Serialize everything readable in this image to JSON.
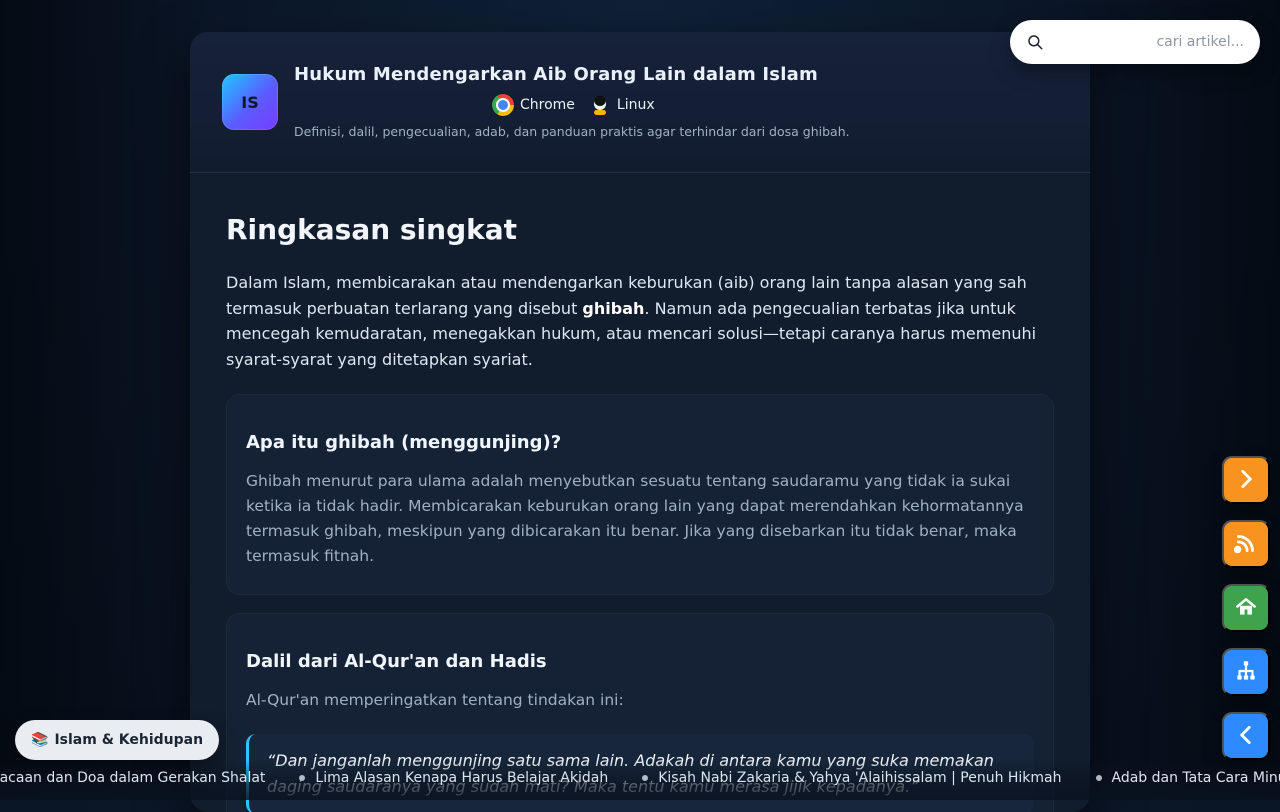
{
  "header": {
    "logo_text": "IS",
    "title": "Hukum Mendengarkan Aib Orang Lain dalam Islam",
    "browser": "Chrome",
    "os": "Linux",
    "subtitle": "Definisi, dalil, pengecualian, adab, dan panduan praktis agar terhindar dari dosa ghibah."
  },
  "search": {
    "placeholder": "cari artikel..."
  },
  "main": {
    "h2": "Ringkasan singkat",
    "lead_prefix": "Dalam Islam, membicarakan atau mendengarkan keburukan (aib) orang lain tanpa alasan yang sah termasuk perbuatan terlarang yang disebut ",
    "lead_bold": "ghibah",
    "lead_suffix": ". Namun ada pengecualian terbatas jika untuk mencegah kemudaratan, menegakkan hukum, atau mencari solusi—tetapi caranya harus memenuhi syarat-syarat yang ditetapkan syariat.",
    "panels": [
      {
        "title": "Apa itu ghibah (menggunjing)?",
        "text": "Ghibah menurut para ulama adalah menyebutkan sesuatu tentang saudaramu yang tidak ia sukai ketika ia tidak hadir. Membicarakan keburukan orang lain yang dapat merendahkan kehormatannya termasuk ghibah, meskipun yang dibicarakan itu benar. Jika yang disebarkan itu tidak benar, maka termasuk fitnah."
      },
      {
        "title": "Dalil dari Al-Qur'an dan Hadis",
        "text": "Al-Qur'an memperingatkan tentang tindakan ini:",
        "quote": "“Dan janganlah menggunjing satu sama lain. Adakah di antara kamu yang suka memakan daging saudaranya yang sudah mati? Maka tentu kamu merasa jijik kepadanya.”"
      }
    ]
  },
  "category": {
    "label": "Islam & Kehidupan",
    "emoji": "📚"
  },
  "ticker": {
    "items": [
      "Bacaan dan Doa dalam Gerakan Shalat",
      "Lima Alasan Kenapa Harus Belajar Akidah",
      "Kisah Nabi Zakaria & Yahya 'Alaihissalam | Penuh Hikmah",
      "Adab dan Tata Cara Minum d"
    ]
  },
  "side_buttons": {
    "next": "next",
    "rss": "rss",
    "home": "home",
    "sitemap": "sitemap",
    "prev": "prev"
  },
  "colors": {
    "accent_blue": "#2e8bff",
    "accent_orange": "#f7931e",
    "accent_green": "#3fa34d",
    "quote_border": "#2ec4ff"
  }
}
